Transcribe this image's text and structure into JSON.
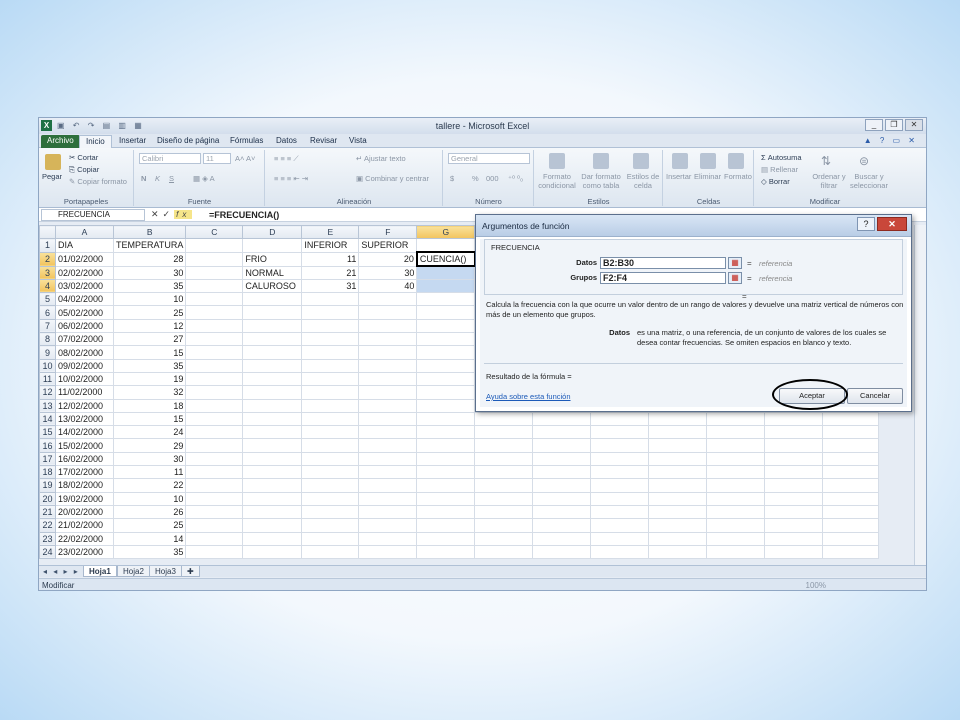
{
  "window": {
    "app_icon": "X",
    "title": "tallere - Microsoft Excel",
    "buttons": [
      "_",
      "❐",
      "✕"
    ]
  },
  "tabs": [
    "Archivo",
    "Inicio",
    "Insertar",
    "Diseño de página",
    "Fórmulas",
    "Datos",
    "Revisar",
    "Vista"
  ],
  "ribbon": {
    "portapapeles": {
      "paste": "Pegar",
      "cut": "Cortar",
      "copy": "Copiar",
      "format_painter": "Copiar formato",
      "label": "Portapapeles"
    },
    "fuente": {
      "font": "Calibri",
      "size": "11",
      "bold": "N",
      "italic": "K",
      "underline": "S",
      "label": "Fuente"
    },
    "alineacion": {
      "wrap": "Ajustar texto",
      "merge": "Combinar y centrar",
      "label": "Alineación"
    },
    "numero": {
      "format": "General",
      "currency": "$",
      "percent": "%",
      "thousands": "000",
      "label": "Número"
    },
    "estilos": {
      "conditional": "Formato condicional",
      "table": "Dar formato como tabla",
      "cell_styles": "Estilos de celda",
      "label": "Estilos"
    },
    "celdas": {
      "insert": "Insertar",
      "delete": "Eliminar",
      "format": "Formato",
      "label": "Celdas"
    },
    "modificar": {
      "autosum": "Autosuma",
      "fill": "Rellenar",
      "clear": "Borrar",
      "sort": "Ordenar y filtrar",
      "find": "Buscar y seleccionar",
      "label": "Modificar"
    }
  },
  "formula_bar": {
    "name_box": "FRECUENCIA",
    "fx": "fx",
    "formula": "=FRECUENCIA()"
  },
  "columns": [
    "A",
    "B",
    "C",
    "D",
    "E",
    "F",
    "G"
  ],
  "rows": [
    [
      "1",
      "DIA",
      "TEMPERATURA",
      "",
      "",
      "INFERIOR",
      "SUPERIOR",
      ""
    ],
    [
      "2",
      "01/02/2000",
      "28",
      "",
      "FRIO",
      "11",
      "20",
      "CUENCIA()"
    ],
    [
      "3",
      "02/02/2000",
      "30",
      "",
      "NORMAL",
      "21",
      "30",
      ""
    ],
    [
      "4",
      "03/02/2000",
      "35",
      "",
      "CALUROSO",
      "31",
      "40",
      ""
    ],
    [
      "5",
      "04/02/2000",
      "10",
      "",
      "",
      "",
      "",
      ""
    ],
    [
      "6",
      "05/02/2000",
      "25",
      "",
      "",
      "",
      "",
      ""
    ],
    [
      "7",
      "06/02/2000",
      "12",
      "",
      "",
      "",
      "",
      ""
    ],
    [
      "8",
      "07/02/2000",
      "27",
      "",
      "",
      "",
      "",
      ""
    ],
    [
      "9",
      "08/02/2000",
      "15",
      "",
      "",
      "",
      "",
      ""
    ],
    [
      "10",
      "09/02/2000",
      "35",
      "",
      "",
      "",
      "",
      ""
    ],
    [
      "11",
      "10/02/2000",
      "19",
      "",
      "",
      "",
      "",
      ""
    ],
    [
      "12",
      "11/02/2000",
      "32",
      "",
      "",
      "",
      "",
      ""
    ],
    [
      "13",
      "12/02/2000",
      "18",
      "",
      "",
      "",
      "",
      ""
    ],
    [
      "14",
      "13/02/2000",
      "15",
      "",
      "",
      "",
      "",
      ""
    ],
    [
      "15",
      "14/02/2000",
      "24",
      "",
      "",
      "",
      "",
      ""
    ],
    [
      "16",
      "15/02/2000",
      "29",
      "",
      "",
      "",
      "",
      ""
    ],
    [
      "17",
      "16/02/2000",
      "30",
      "",
      "",
      "",
      "",
      ""
    ],
    [
      "18",
      "17/02/2000",
      "11",
      "",
      "",
      "",
      "",
      ""
    ],
    [
      "19",
      "18/02/2000",
      "22",
      "",
      "",
      "",
      "",
      ""
    ],
    [
      "20",
      "19/02/2000",
      "10",
      "",
      "",
      "",
      "",
      ""
    ],
    [
      "21",
      "20/02/2000",
      "26",
      "",
      "",
      "",
      "",
      ""
    ],
    [
      "22",
      "21/02/2000",
      "25",
      "",
      "",
      "",
      "",
      ""
    ],
    [
      "23",
      "22/02/2000",
      "14",
      "",
      "",
      "",
      "",
      ""
    ],
    [
      "24",
      "23/02/2000",
      "35",
      "",
      "",
      "",
      "",
      ""
    ]
  ],
  "sheets": [
    "Hoja1",
    "Hoja2",
    "Hoja3"
  ],
  "status": {
    "mode": "Modificar",
    "zoom": "100%"
  },
  "dialog": {
    "title": "Argumentos de función",
    "function_name": "FRECUENCIA",
    "args": [
      {
        "label": "Datos",
        "value": "B2:B30",
        "result": "referencia"
      },
      {
        "label": "Grupos",
        "value": "F2:F4",
        "result": "referencia"
      }
    ],
    "eq": "=",
    "description": "Calcula la frecuencia con la que ocurre un valor dentro de un rango de valores y devuelve una matriz vertical de números con más de un elemento que grupos.",
    "arg_help_label": "Datos",
    "arg_help": "es una matriz, o una referencia, de un conjunto de valores de los cuales se desea contar frecuencias. Se omiten espacios en blanco y texto.",
    "result_label": "Resultado de la fórmula =",
    "help_link": "Ayuda sobre esta función",
    "ok": "Aceptar",
    "cancel": "Cancelar"
  },
  "colors": {
    "accent_green": "#1e7145",
    "selection": "#c5d9f1",
    "header_highlight": "#f2c45e"
  }
}
